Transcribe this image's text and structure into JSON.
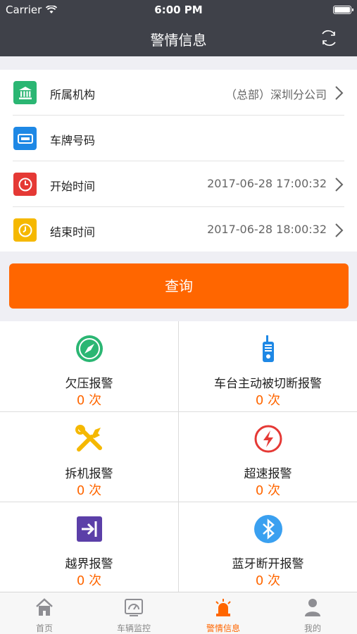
{
  "status_bar": {
    "carrier": "Carrier",
    "time": "6:00 PM"
  },
  "nav": {
    "title": "警情信息"
  },
  "form": {
    "rows": [
      {
        "label": "所属机构",
        "value": "（总部）深圳分公司"
      },
      {
        "label": "车牌号码",
        "value": ""
      },
      {
        "label": "开始时间",
        "value": "2017-06-28 17:00:32"
      },
      {
        "label": "结束时间",
        "value": "2017-06-28 18:00:32"
      }
    ]
  },
  "query_button": "查询",
  "alarms": [
    {
      "name": "欠压报警",
      "count": "0 次"
    },
    {
      "name": "车台主动被切断报警",
      "count": "0 次"
    },
    {
      "name": "拆机报警",
      "count": "0 次"
    },
    {
      "name": "超速报警",
      "count": "0 次"
    },
    {
      "name": "越界报警",
      "count": "0 次"
    },
    {
      "name": "蓝牙断开报警",
      "count": "0 次"
    }
  ],
  "tabs": [
    {
      "label": "首页",
      "icon": "home-icon"
    },
    {
      "label": "车辆监控",
      "icon": "monitor-icon"
    },
    {
      "label": "警情信息",
      "icon": "alarm-light-icon"
    },
    {
      "label": "我的",
      "icon": "user-icon"
    }
  ],
  "colors": {
    "accent": "#ff6600",
    "nav_bg": "#3f4149",
    "green": "#2bb673",
    "blue": "#1e88e5",
    "red": "#e53935",
    "yellow": "#f5b800",
    "purple": "#5b3fa8"
  }
}
